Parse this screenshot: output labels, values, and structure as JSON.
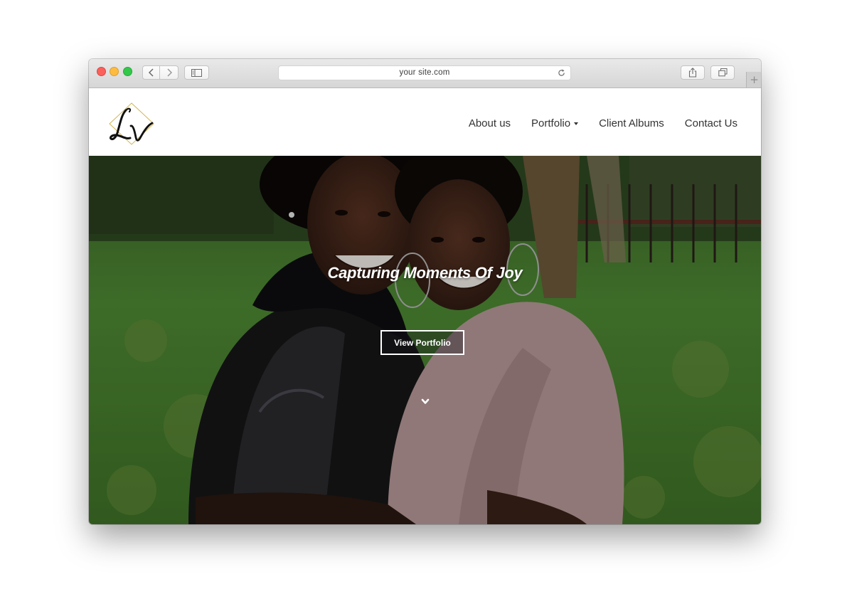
{
  "browser": {
    "address": "your site.com",
    "buttons": {
      "back_icon": "chevron-left-icon",
      "forward_icon": "chevron-right-icon",
      "sidebar_icon": "sidebar-icon",
      "share_icon": "share-icon",
      "tabs_icon": "tabs-overview-icon",
      "reload_icon": "reload-icon",
      "new_tab_icon": "plus-icon"
    },
    "traffic_lights": {
      "close": "#fc605b",
      "minimize": "#fdbc40",
      "zoom": "#34c84a"
    }
  },
  "site": {
    "logo_text": "LV",
    "nav": {
      "about": "About us",
      "portfolio": "Portfolio",
      "client_albums": "Client Albums",
      "contact": "Contact Us"
    },
    "hero": {
      "title": "Capturing Moments Of Joy",
      "button": "View Portfolio",
      "scroll_icon": "chevron-down-icon"
    }
  },
  "colors": {
    "nav_text": "#333333",
    "hero_text": "#ffffff",
    "logo_gold": "#c9a227"
  }
}
